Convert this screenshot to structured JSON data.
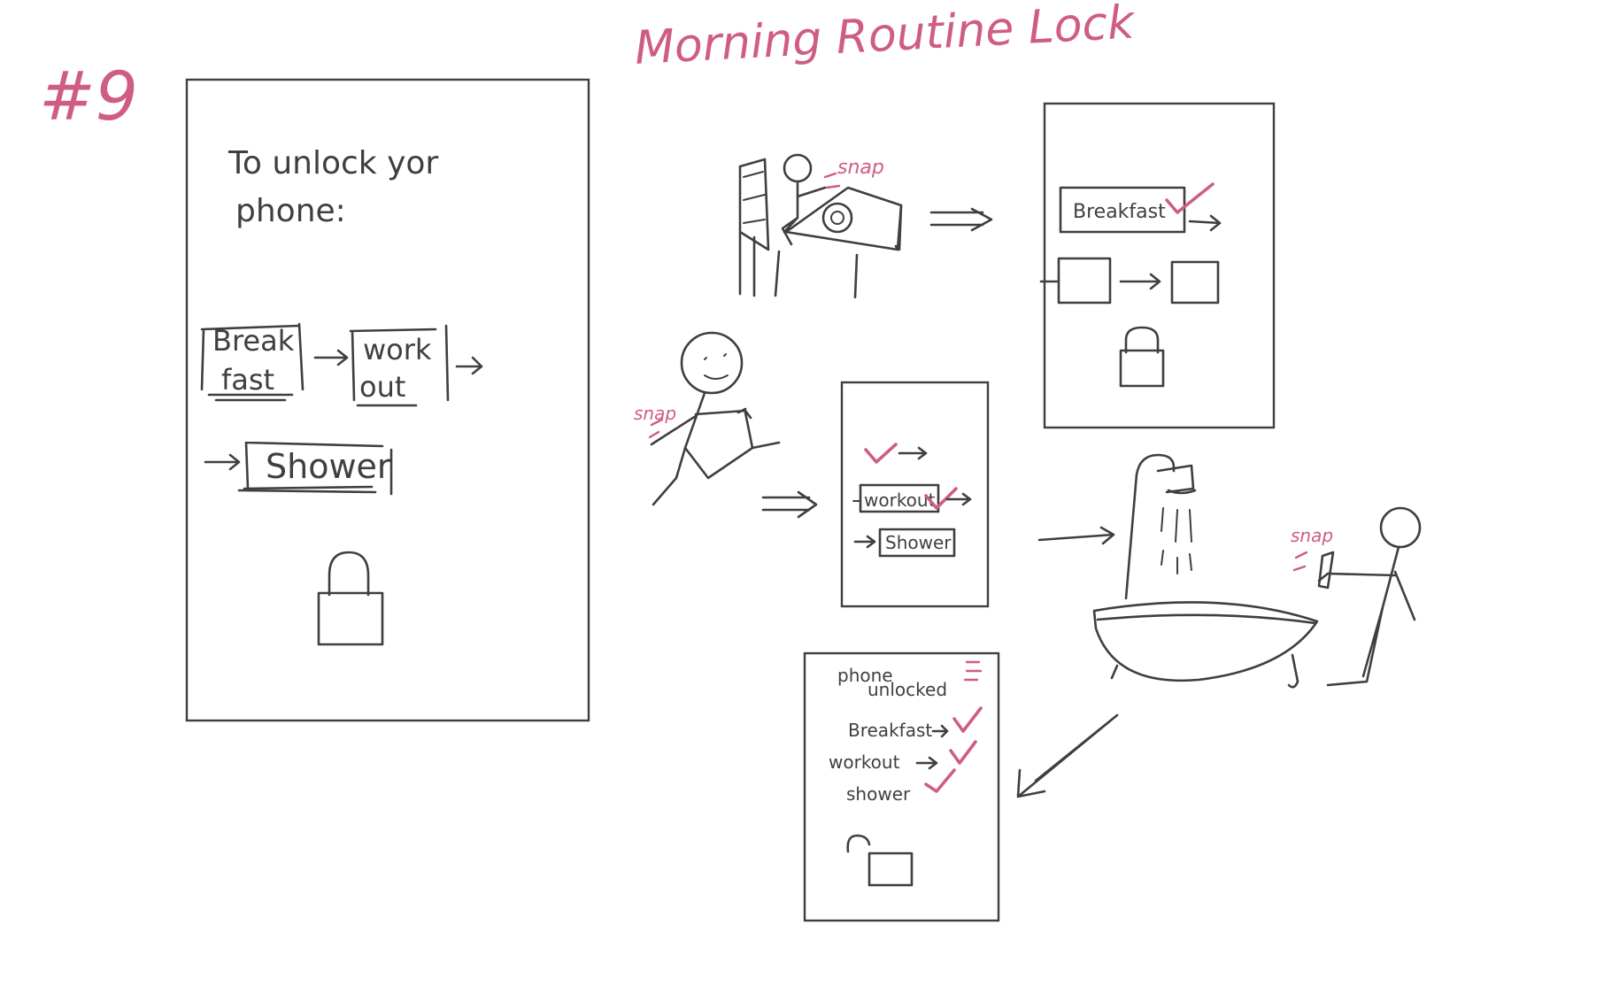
{
  "title": "Morning Routine Lock",
  "sketch_number": "#9",
  "colors": {
    "ink": "#3f3f3f",
    "accent": "#cf5d83",
    "background": "#ffffff"
  },
  "main_screen": {
    "prompt_line1": "To unlock yor",
    "prompt_line2": "phone:",
    "task_breakfast_1": "Break",
    "task_breakfast_2": "fast",
    "task_workout_1": "work",
    "task_workout_2": "out",
    "task_shower": "Shower",
    "lock_icon": "lock-icon"
  },
  "scene_breakfast": {
    "sound": "snap"
  },
  "screen_after_breakfast": {
    "task": "Breakfast",
    "lock_icon": "lock-icon"
  },
  "scene_workout": {
    "sound": "snap"
  },
  "screen_after_workout": {
    "task_workout": "workout",
    "task_shower": "Shower"
  },
  "scene_shower": {
    "sound": "snap"
  },
  "final_screen": {
    "status_line1": "phone",
    "status_line2": "unlocked",
    "items": [
      {
        "label": "Breakfast"
      },
      {
        "label": "workout"
      },
      {
        "label": "shower"
      }
    ],
    "lock_icon": "unlocked-icon"
  }
}
